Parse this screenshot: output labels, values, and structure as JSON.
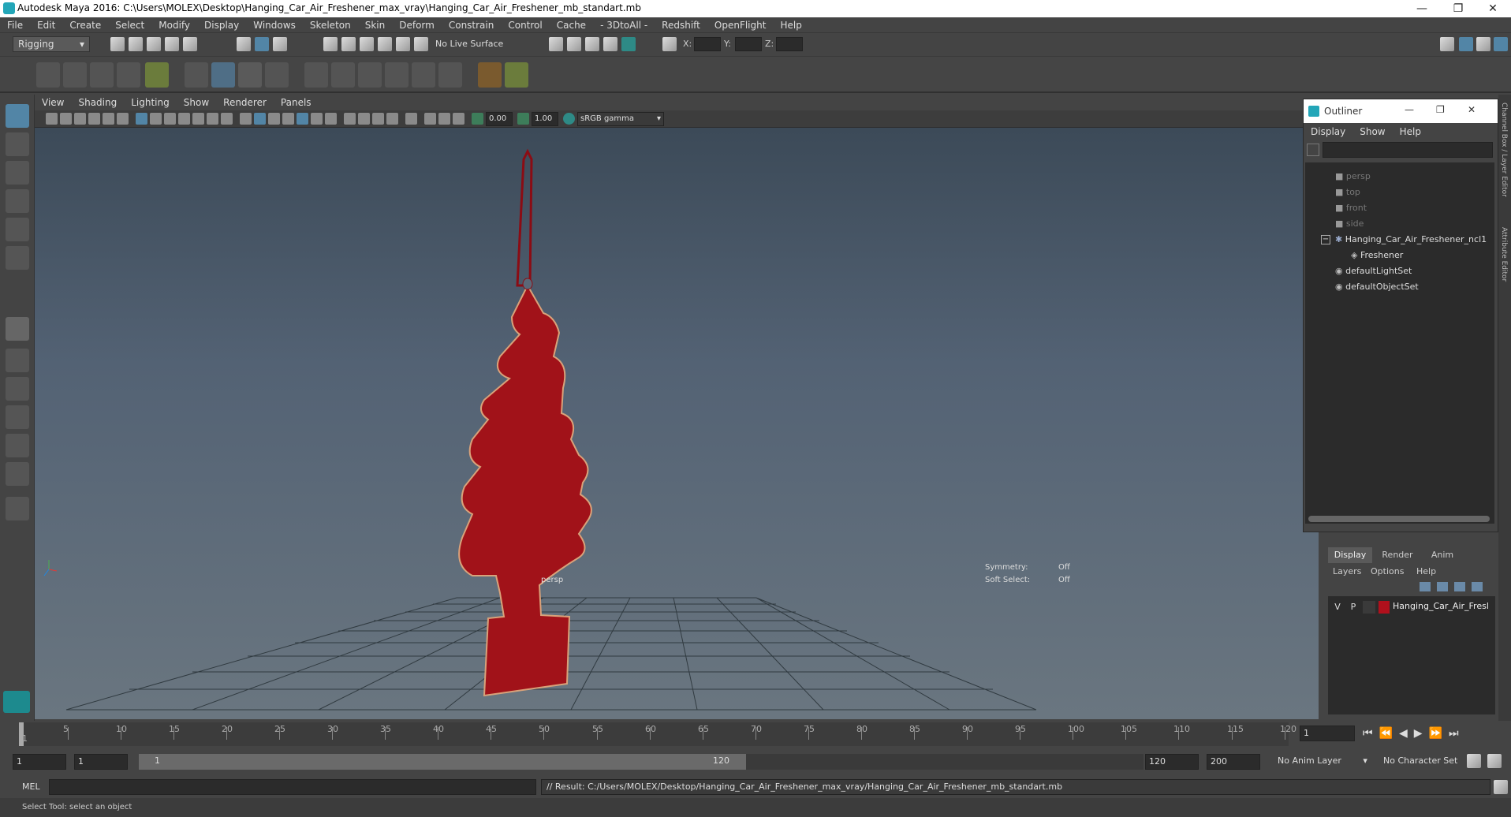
{
  "window": {
    "title": "Autodesk Maya 2016: C:\\Users\\MOLEX\\Desktop\\Hanging_Car_Air_Freshener_max_vray\\Hanging_Car_Air_Freshener_mb_standart.mb",
    "minimize": "—",
    "restore": "❐",
    "close": "✕"
  },
  "menubar": [
    "File",
    "Edit",
    "Create",
    "Select",
    "Modify",
    "Display",
    "Windows",
    "Skeleton",
    "Skin",
    "Deform",
    "Constrain",
    "Control",
    "Cache",
    "- 3DtoAll -",
    "Redshift",
    "OpenFlight",
    "Help"
  ],
  "status_line": {
    "mode": "Rigging",
    "live_surface": "No Live Surface",
    "x_label": "X:",
    "y_label": "Y:",
    "z_label": "Z:"
  },
  "viewport": {
    "menu": [
      "View",
      "Shading",
      "Lighting",
      "Show",
      "Renderer",
      "Panels"
    ],
    "exposure": "0.00",
    "gamma": "1.00",
    "color_space": "sRGB gamma",
    "camera_label": "persp",
    "symmetry_label": "Symmetry:",
    "symmetry_value": "Off",
    "soft_select_label": "Soft Select:",
    "soft_select_value": "Off"
  },
  "outliner": {
    "title": "Outliner",
    "menu": [
      "Display",
      "Show",
      "Help"
    ],
    "items": [
      {
        "label": "persp",
        "dim": true
      },
      {
        "label": "top",
        "dim": true
      },
      {
        "label": "front",
        "dim": true
      },
      {
        "label": "side",
        "dim": true
      },
      {
        "label": "Hanging_Car_Air_Freshener_ncl1",
        "dim": false
      },
      {
        "label": "Freshener",
        "dim": false
      },
      {
        "label": "defaultLightSet",
        "dim": false
      },
      {
        "label": "defaultObjectSet",
        "dim": false
      }
    ]
  },
  "right_strip": {
    "channel_box": "Channel Box / Layer Editor",
    "attribute_editor": "Attribute Editor"
  },
  "layers": {
    "tabs": [
      "Display",
      "Render",
      "Anim"
    ],
    "menu": [
      "Layers",
      "Options",
      "Help"
    ],
    "row": {
      "v": "V",
      "p": "P",
      "name": "Hanging_Car_Air_Fresl",
      "color": "#b0101c"
    }
  },
  "timeline": {
    "ticks": [
      "5",
      "10",
      "15",
      "20",
      "25",
      "30",
      "35",
      "40",
      "45",
      "50",
      "55",
      "60",
      "65",
      "70",
      "75",
      "80",
      "85",
      "90",
      "95",
      "100",
      "105",
      "110",
      "115",
      "120"
    ],
    "start_label": "1",
    "current_frame": "1"
  },
  "range": {
    "start": "1",
    "start2": "1",
    "slider_start": "1",
    "slider_end": "120",
    "end": "120",
    "end2": "200",
    "anim_layer": "No Anim Layer",
    "char_set": "No Character Set"
  },
  "cmd": {
    "lang": "MEL",
    "result": "// Result: C:/Users/MOLEX/Desktop/Hanging_Car_Air_Freshener_max_vray/Hanging_Car_Air_Freshener_mb_standart.mb"
  },
  "help_line": "Select Tool: select an object",
  "colors": {
    "object_red": "#a11219",
    "accent_blue": "#5285a6"
  }
}
